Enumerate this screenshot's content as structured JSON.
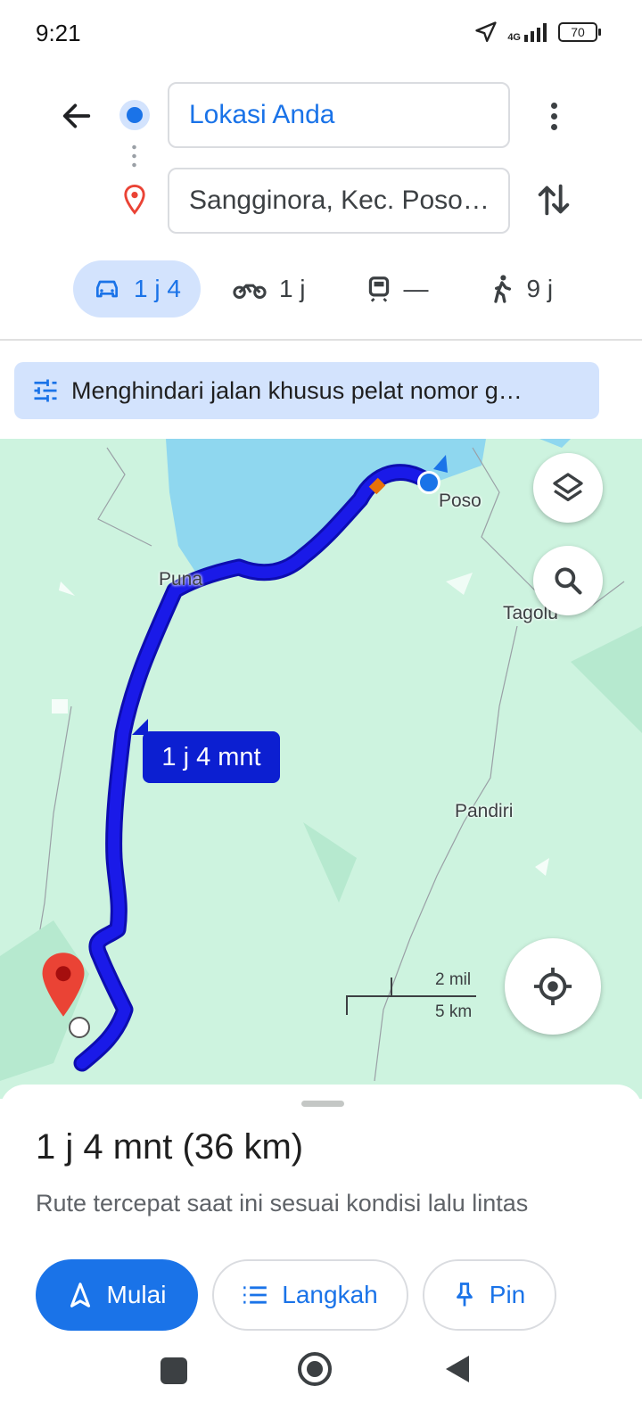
{
  "status_bar": {
    "time": "9:21",
    "network": "4G",
    "battery": "70"
  },
  "directions": {
    "origin": "Lokasi Anda",
    "destination": "Sangginora, Kec. Poso…"
  },
  "modes": [
    {
      "name": "car",
      "label": "1 j 4",
      "active": true
    },
    {
      "name": "motorcycle",
      "label": "1 j",
      "active": false
    },
    {
      "name": "transit",
      "label": "—",
      "active": false
    },
    {
      "name": "walk",
      "label": "9 j",
      "active": false
    }
  ],
  "avoid_chip": "Menghindari jalan khusus pelat nomor g…",
  "map": {
    "places": [
      "Poso",
      "Puna",
      "Tagolu",
      "Pandiri"
    ],
    "eta_bubble": "1 j 4 mnt",
    "scale": {
      "miles": "2 mil",
      "km": "5 km"
    },
    "route_color": "#1a1ae8",
    "water_color": "#8fd7ef",
    "land_color": "#cdf3df"
  },
  "sheet": {
    "summary": "1 j 4 mnt (36 km)",
    "subtitle": "Rute tercepat saat ini sesuai kondisi lalu lintas",
    "buttons": {
      "start": "Mulai",
      "steps": "Langkah",
      "pin": "Pin"
    }
  },
  "colors": {
    "accent": "#1a73e8",
    "chip": "#d3e3fd",
    "destination_pin": "#ea4335"
  }
}
